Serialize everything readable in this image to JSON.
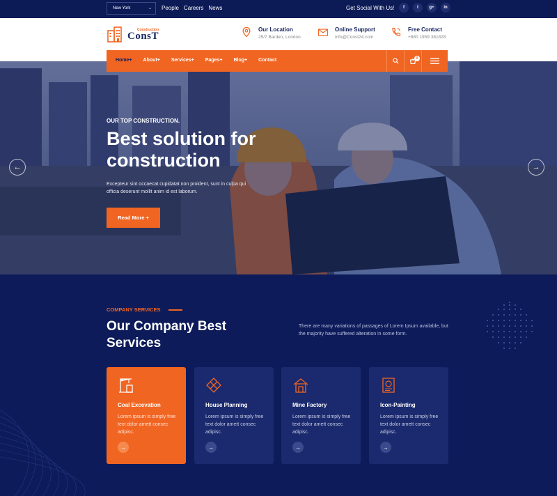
{
  "topbar": {
    "city": "New York",
    "links": [
      "People",
      "Careers",
      "News"
    ],
    "social_label": "Get Social With Us!",
    "social_icons": [
      "f",
      "t",
      "g+",
      "in"
    ]
  },
  "header": {
    "logo_main": "ConsT",
    "logo_sub": "Construction",
    "location_title": "Our Location",
    "location_sub": "25/7 Barden, London",
    "support_title": "Online Support",
    "support_sub": "info@Const24.com",
    "contact_title": "Free Contact",
    "contact_sub": "+880 1959 381828"
  },
  "nav": {
    "items": [
      "Home+",
      "About+",
      "Services+",
      "Pages+",
      "Blog+",
      "Contact"
    ],
    "cart_count": "0"
  },
  "hero": {
    "eyebrow": "OUR TOP CONSTRUCTION.",
    "title": "Best solution for construction",
    "desc": "Excepteur sint occaecat cupidatat non proident, sunt in culpa qui officia deserunt mollit anim id est laborum.",
    "button": "Read More +",
    "prev": "←",
    "next": "→"
  },
  "services": {
    "eyebrow": "COMPANY SERVICES",
    "title": "Our Company Best Services",
    "desc": "There are many variations of passages of Lorem Ipsum available, but the majority have suffered alteration in some form.",
    "cards": [
      {
        "title": "Coal Excevation",
        "desc": "Lorem ipsum is simply free text dolor amett consec adipisc.",
        "icon": "crane-icon"
      },
      {
        "title": "House Planning",
        "desc": "Lorem ipsum is simply free text dolor amett consec adipisc.",
        "icon": "tools-icon"
      },
      {
        "title": "Mine Factory",
        "desc": "Lorem ipsum is simply free text dolor amett consec adipisc.",
        "icon": "house-icon"
      },
      {
        "title": "Icon-Painting",
        "desc": "Lorem ipsum is simply free text dolor amett consec adipisc.",
        "icon": "blueprint-icon"
      }
    ],
    "arrow": "→"
  },
  "colors": {
    "accent": "#f16522",
    "navy": "#0d1b5a"
  }
}
